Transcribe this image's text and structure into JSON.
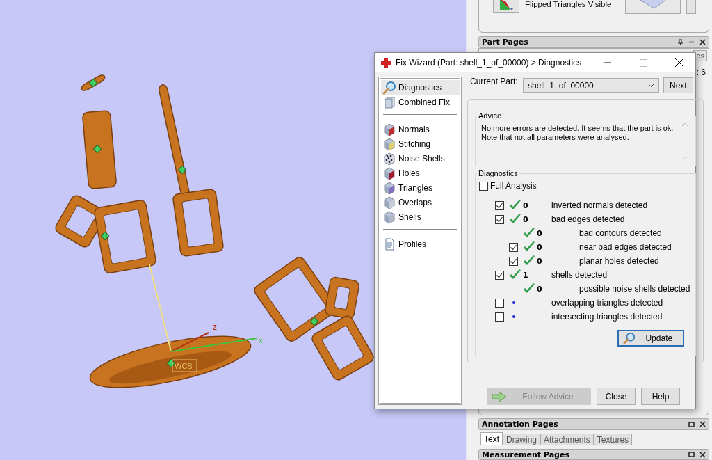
{
  "viewport": {
    "axis_labels": [
      "z",
      "x"
    ],
    "origin_label": "WCS"
  },
  "tool_panel": {
    "button_label": "Flipped Triangles Visible"
  },
  "part_pages": {
    "title": "Part Pages",
    "tab_peek": "es",
    "info_peek": ": 6"
  },
  "dialog": {
    "title": "Fix Wizard (Part: shell_1_of_00000) > Diagnostics",
    "nav_groups": [
      [
        {
          "label": "Diagnostics",
          "selected": true
        },
        {
          "label": "Combined Fix",
          "selected": false
        }
      ],
      [
        {
          "label": "Normals",
          "selected": false
        },
        {
          "label": "Stitching",
          "selected": false
        },
        {
          "label": "Noise Shells",
          "selected": false
        },
        {
          "label": "Holes",
          "selected": false
        },
        {
          "label": "Triangles",
          "selected": false
        },
        {
          "label": "Overlaps",
          "selected": false
        },
        {
          "label": "Shells",
          "selected": false
        }
      ],
      [
        {
          "label": "Profiles",
          "selected": false
        }
      ]
    ],
    "current_part_label": "Current Part:",
    "current_part": "shell_1_of_00000",
    "next_button": "Next",
    "advice": {
      "title": "Advice",
      "text": "No more errors are detected. It seems that the part is ok. Note that not all parameters were analysed."
    },
    "diagnostics": {
      "title": "Diagnostics",
      "full_analysis": {
        "label": "Full Analysis",
        "checked": false
      },
      "rows": [
        {
          "kind": "checkbox",
          "checked": true,
          "passed": true,
          "count": "0",
          "label": "inverted normals detected"
        },
        {
          "kind": "checkbox",
          "checked": true,
          "passed": true,
          "count": "0",
          "label": "bad edges detected",
          "children": [
            {
              "kind": "plain",
              "passed": true,
              "count": "0",
              "label": "bad contours detected"
            },
            {
              "kind": "checkbox",
              "checked": true,
              "passed": true,
              "count": "0",
              "label": "near bad edges detected"
            },
            {
              "kind": "checkbox",
              "checked": true,
              "passed": true,
              "count": "0",
              "label": "planar holes detected"
            }
          ]
        },
        {
          "kind": "checkbox",
          "checked": true,
          "passed": true,
          "count": "1",
          "label": "shells detected",
          "children": [
            {
              "kind": "plain",
              "passed": true,
              "count": "0",
              "label": "possible noise shells detected"
            }
          ]
        },
        {
          "kind": "checkbox",
          "checked": false,
          "passed": false,
          "label": "overlapping triangles detected"
        },
        {
          "kind": "checkbox",
          "checked": false,
          "passed": false,
          "label": "intersecting triangles detected"
        }
      ]
    },
    "update_button": "Update",
    "buttons": [
      {
        "kind": "follow",
        "label": "Follow Advice",
        "disabled": true
      },
      {
        "kind": "plain",
        "label": "Close",
        "disabled": false
      },
      {
        "kind": "plain",
        "label": "Help",
        "disabled": false
      }
    ]
  },
  "annotation_pages": {
    "title": "Annotation Pages",
    "tabs": [
      {
        "label": "Text",
        "selected": true
      },
      {
        "label": "Drawing",
        "selected": false
      },
      {
        "label": "Attachments",
        "selected": false
      },
      {
        "label": "Textures",
        "selected": false
      }
    ]
  },
  "measurement_pages": {
    "title": "Measurement Pages"
  }
}
